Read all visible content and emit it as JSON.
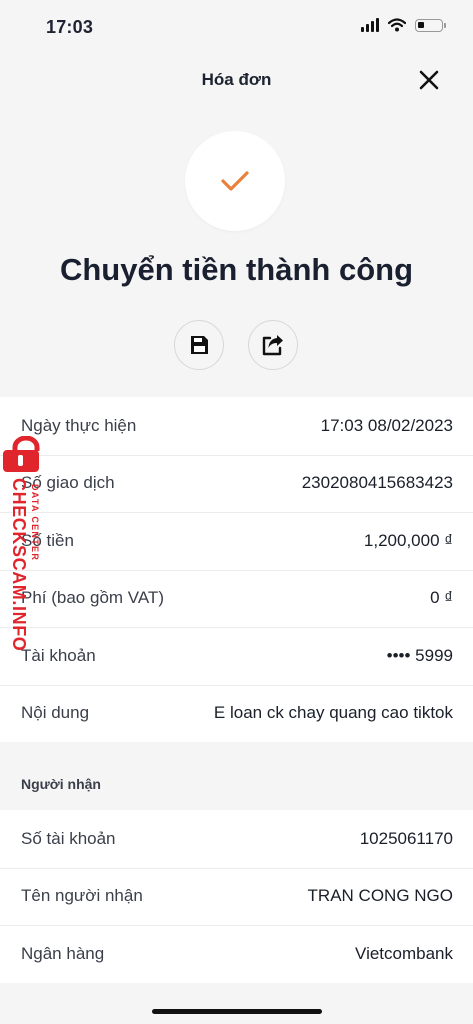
{
  "status_bar": {
    "time": "17:03",
    "battery_level": 0.3
  },
  "header": {
    "title": "Hóa đơn",
    "close_icon": "close-icon"
  },
  "result": {
    "title": "Chuyển tiền thành công",
    "icon": "checkmark-icon",
    "accent_color": "#E8813C"
  },
  "actions": {
    "save_icon": "floppy-disk-icon",
    "share_icon": "share-icon"
  },
  "transaction": [
    {
      "label": "Ngày thực hiện",
      "value": "17:03 08/02/2023"
    },
    {
      "label": "Số giao dịch",
      "value": "2302080415683423"
    },
    {
      "label": "Số tiền",
      "value": "1,200,000 ₫"
    },
    {
      "label": "Phí (bao gồm VAT)",
      "value": "0 ₫"
    },
    {
      "label": "Tài khoản",
      "value": "•••• 5999"
    },
    {
      "label": "Nội dung",
      "value": "E loan ck chay quang cao tiktok"
    }
  ],
  "recipient": {
    "section_title": "Người nhận",
    "rows": [
      {
        "label": "Số tài khoản",
        "value": "1025061170"
      },
      {
        "label": "Tên người nhận",
        "value": "TRAN CONG NGO"
      },
      {
        "label": "Ngân hàng",
        "value": "Vietcombank"
      }
    ]
  },
  "watermark": {
    "main": "CHECKSCAM.INFO",
    "sub": "DATA CENTER",
    "color": "#E0262C"
  }
}
